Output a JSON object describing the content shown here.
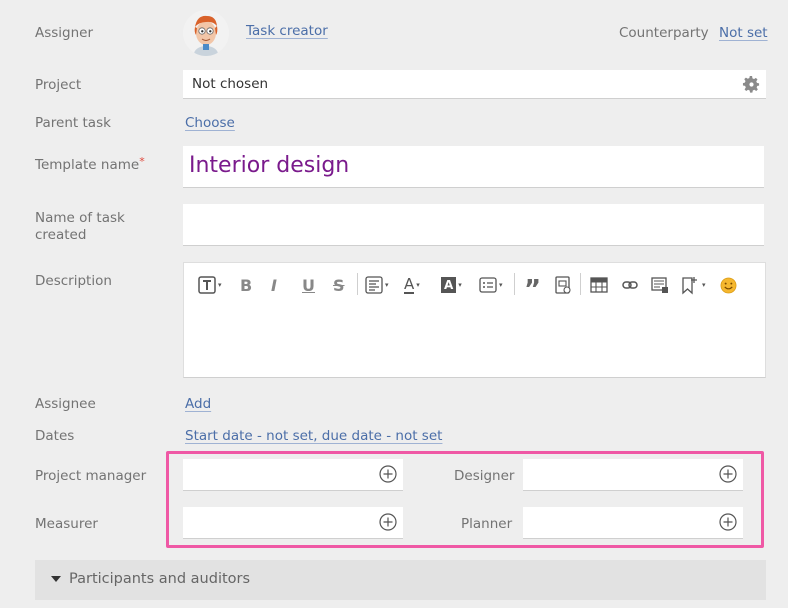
{
  "assigner": {
    "label": "Assigner",
    "value": "Task creator"
  },
  "counterparty": {
    "label": "Counterparty",
    "value": "Not set"
  },
  "project": {
    "label": "Project",
    "value": "Not chosen"
  },
  "parent_task": {
    "label": "Parent task",
    "action": "Choose"
  },
  "template_name": {
    "label": "Template name",
    "required_mark": "*",
    "value": "Interior design"
  },
  "task_name": {
    "label_line1": "Name of task",
    "label_line2": "created",
    "value": ""
  },
  "description": {
    "label": "Description",
    "value": ""
  },
  "assignee": {
    "label": "Assignee",
    "action": "Add"
  },
  "dates": {
    "label": "Dates",
    "value": "Start date - not set, due date - not set"
  },
  "roles": {
    "project_manager": {
      "label": "Project manager",
      "value": ""
    },
    "designer": {
      "label": "Designer",
      "value": ""
    },
    "measurer": {
      "label": "Measurer",
      "value": ""
    },
    "planner": {
      "label": "Planner",
      "value": ""
    }
  },
  "participants": {
    "label": "Participants and auditors"
  },
  "colors": {
    "accent_link": "#4b6ea8",
    "title_purple": "#7a1a8c",
    "highlight": "#ef58a5",
    "required": "#e0483c"
  },
  "toolbar_icons": [
    "text-format-icon",
    "bold-icon",
    "italic-icon",
    "underline-icon",
    "strikethrough-icon",
    "align-icon",
    "font-color-icon",
    "background-color-icon",
    "list-icon",
    "quote-icon",
    "insert-file-icon",
    "table-icon",
    "link-icon",
    "insert-image-icon",
    "bookmark-icon",
    "emoji-icon"
  ],
  "toolbar_glyphs": {
    "bold": "B",
    "italic": "I",
    "underline": "U",
    "strike": "S",
    "font_color": "A",
    "bg_color": "A",
    "quote": "”",
    "text": "T",
    "caret": "▾"
  }
}
